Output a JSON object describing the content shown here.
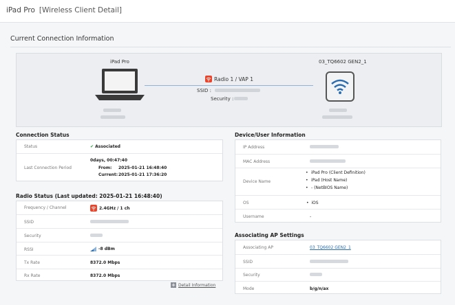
{
  "window": {
    "title": "iPad Pro",
    "subtitle": "[Wireless Client Detail]"
  },
  "section": {
    "title": "Current Connection Information"
  },
  "diagram": {
    "client_name": "iPad Pro",
    "ap_name": "03_TQ6602 GEN2_1",
    "radio": "Radio 1 / VAP 1",
    "ssid_label": "SSID :",
    "security_label": "Security :"
  },
  "connection_status": {
    "title": "Connection Status",
    "status_label": "Status",
    "status_value": "Associated",
    "period_label": "Last Connection Period",
    "duration": "0days, 00:47:40",
    "from_label": "From:",
    "from_value": "2025-01-21 16:48:40",
    "current_label": "Current:",
    "current_value": "2025-01-21 17:36:20"
  },
  "radio_status": {
    "title": "Radio Status (Last updated: 2025-01-21 16:48:40)",
    "freq_label": "Frequency / Channel",
    "freq_value": "2.4GHz / 1 ch",
    "ssid_label": "SSID",
    "security_label": "Security",
    "rssi_label": "RSSI",
    "rssi_value": "-8 dBm",
    "tx_label": "Tx Rate",
    "tx_value": "8372.0 Mbps",
    "rx_label": "Rx Rate",
    "rx_value": "8372.0 Mbps",
    "detail_link": "Detail Information"
  },
  "device_info": {
    "title": "Device/User Information",
    "ip_label": "IP Address",
    "mac_label": "MAC Address",
    "name_label": "Device Name",
    "names": [
      "iPad Pro (Client Definition)",
      "iPad (Host Name)",
      "- (NetBIOS Name)"
    ],
    "os_label": "OS",
    "os_value": "iOS",
    "user_label": "Username",
    "user_value": "-"
  },
  "ap_settings": {
    "title": "Associating AP Settings",
    "ap_label": "Associating AP",
    "ap_value": "03_TQ6602 GEN2_1",
    "ssid_label": "SSID",
    "security_label": "Security",
    "mode_label": "Mode",
    "mode_value": "b/g/n/ax"
  },
  "colors": {
    "accent": "#e8452c",
    "ok": "#2ea043",
    "link": "#2b6cb0"
  }
}
